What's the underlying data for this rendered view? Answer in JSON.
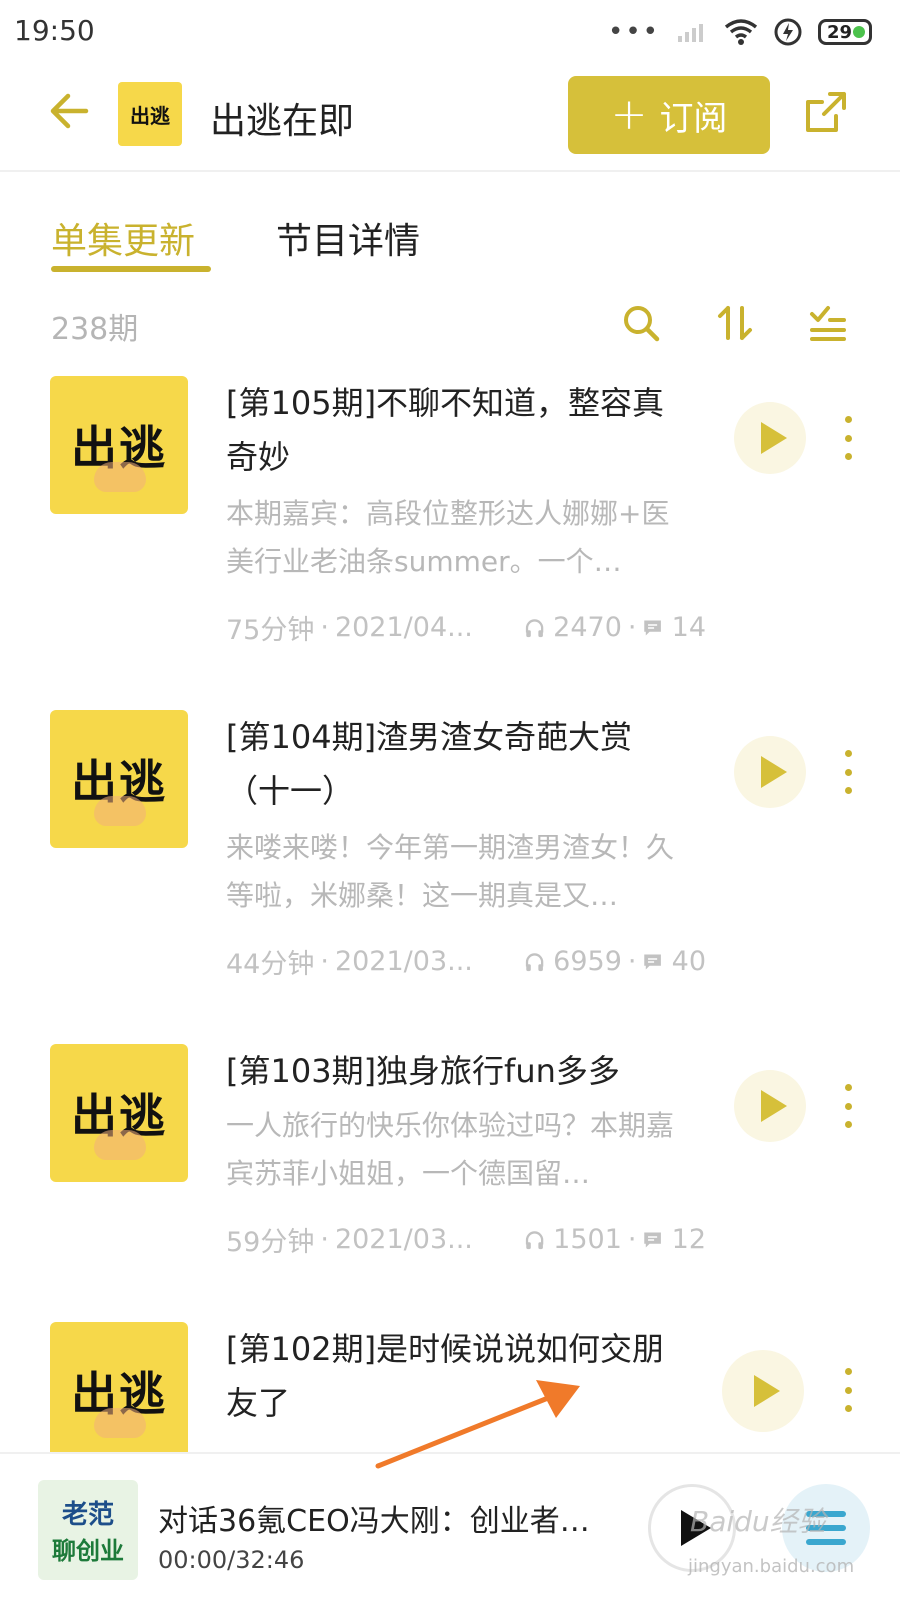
{
  "status_bar": {
    "time": "19:50",
    "dots": "•••",
    "battery": "29",
    "icons": [
      "signal-icon",
      "wifi-icon",
      "charging-icon",
      "battery-icon"
    ]
  },
  "header": {
    "back_icon": "arrow-left-icon",
    "logo_text": "出逃",
    "title": "出逃在即",
    "subscribe_label": "订阅",
    "subscribe_plus": "+",
    "share_icon": "share-icon"
  },
  "tabs": [
    {
      "label": "单集更新",
      "active": true
    },
    {
      "label": "节目详情",
      "active": false
    }
  ],
  "toolbar": {
    "episode_count": "238期",
    "icons": [
      "search-icon",
      "sort-icon",
      "filter-list-icon"
    ]
  },
  "colors": {
    "accent": "#d6c03a",
    "accent_text": "#c9b22e",
    "cover_bg": "#f6d84a",
    "muted_text": "#b8b8b8"
  },
  "episodes": [
    {
      "cover_text": "出逃",
      "title": "[第105期]不聊不知道，整容真奇妙",
      "desc": "本期嘉宾：高段位整形达人娜娜+医美行业老油条summer。一个…",
      "duration": "75分钟",
      "date": "2021/04...",
      "plays": "2470",
      "comments": "14"
    },
    {
      "cover_text": "出逃",
      "title": "[第104期]渣男渣女奇葩大赏（十一）",
      "desc": "来喽来喽！今年第一期渣男渣女！久等啦，米娜桑！这一期真是又…",
      "duration": "44分钟",
      "date": "2021/03...",
      "plays": "6959",
      "comments": "40"
    },
    {
      "cover_text": "出逃",
      "title": "[第103期]独身旅行fun多多",
      "desc": "一人旅行的快乐你体验过吗？本期嘉宾苏菲小姐姐，一个德国留…",
      "duration": "59分钟",
      "date": "2021/03...",
      "plays": "1501",
      "comments": "12"
    },
    {
      "cover_text": "出逃",
      "title": "[第102期]是时候说说如何交朋友了",
      "desc": "",
      "duration": "",
      "date": "",
      "plays": "",
      "comments": ""
    }
  ],
  "player": {
    "cover_line1": "老范",
    "cover_line2": "聊创业",
    "title": "对话36氪CEO冯大刚：创业者…",
    "time": "00:00/32:46"
  },
  "watermark": {
    "text": "Baidu经验",
    "sub": "jingyan.baidu.com"
  }
}
